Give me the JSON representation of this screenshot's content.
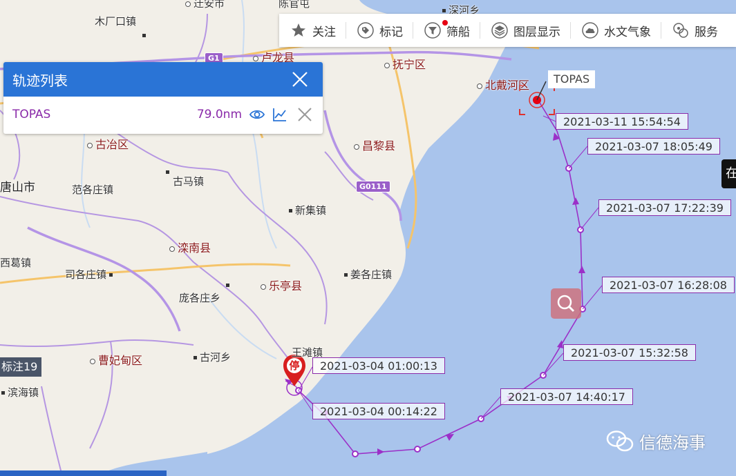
{
  "toolbar": {
    "items": [
      {
        "label": "关注",
        "icon": "star-icon"
      },
      {
        "label": "标记",
        "icon": "tag-icon"
      },
      {
        "label": "筛船",
        "icon": "filter-icon"
      },
      {
        "label": "图层显示",
        "icon": "layers-icon"
      },
      {
        "label": "水文气象",
        "icon": "weather-icon"
      },
      {
        "label": "服务",
        "icon": "service-icon"
      }
    ]
  },
  "track_panel": {
    "title": "轨迹列表",
    "ship_name": "TOPAS",
    "distance": "79.0nm"
  },
  "map": {
    "places": {
      "top_cut_1": "迁安市",
      "top_cut_2": "陈官屯",
      "top_cut_3": "深河乡",
      "mu_chang_kou": "木厂口镇",
      "lu_long": "卢龙县",
      "fu_ning": "抚宁区",
      "bei_dai_he": "北戴河区",
      "gu_ye": "古冶区",
      "chang_li": "昌黎县",
      "tang_shan": "唐山市",
      "fan_ge_zhuang": "范各庄镇",
      "gu_ma": "古马镇",
      "xin_ji": "新集镇",
      "luan_nan": "滦南县",
      "xi_ge": "西葛镇",
      "si_ge_zhuang": "司各庄镇",
      "le_ting": "乐亭县",
      "jiang_ge_zhuang": "姜各庄镇",
      "pang_ge_zhuang": "庞各庄乡",
      "wang_tan": "王滩镇",
      "cao_fei_dian": "曹妃甸区",
      "gu_he": "古河乡",
      "bin_hai": "滨海镇"
    },
    "road_badges": [
      "G1",
      "G0111"
    ],
    "marker_badge": "标注19",
    "right_tip": "在",
    "stop_marker": "停",
    "ship_tag": "TOPAS"
  },
  "track": {
    "timestamps": [
      "2021-03-11 15:54:54",
      "2021-03-07 18:05:49",
      "2021-03-07 17:22:39",
      "2021-03-07 16:28:08",
      "2021-03-07 15:32:58",
      "2021-03-07 14:40:17",
      "2021-03-04 01:00:13",
      "2021-03-04 00:14:22"
    ],
    "color": "#9b30c8"
  },
  "watermark": "信德海事",
  "colors": {
    "sea": "#a9c4ec",
    "land": "#f2efe8",
    "panel_header": "#2a74d6",
    "track": "#9b30c8",
    "ship": "#e60012"
  }
}
